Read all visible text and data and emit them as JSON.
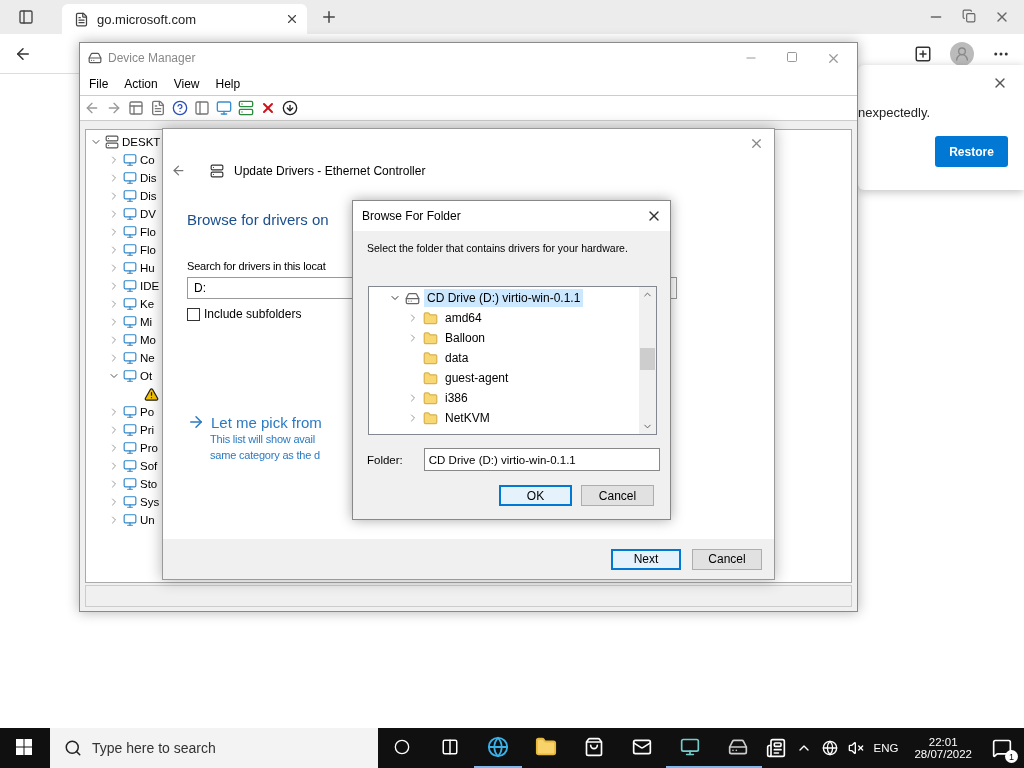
{
  "browser": {
    "tab": {
      "title": "go.microsoft.com"
    },
    "restore_popup": {
      "message": "nexpectedly.",
      "button": "Restore"
    }
  },
  "device_manager": {
    "title": "Device Manager",
    "menu": [
      "File",
      "Action",
      "View",
      "Help"
    ],
    "tree": {
      "label": "DESKT",
      "expanded": true,
      "children": [
        {
          "label": "Co",
          "expanded": false
        },
        {
          "label": "Dis",
          "expanded": false
        },
        {
          "label": "Dis",
          "expanded": false
        },
        {
          "label": "DV",
          "expanded": false
        },
        {
          "label": "Flo",
          "expanded": false
        },
        {
          "label": "Flo",
          "expanded": false
        },
        {
          "label": "Hu",
          "expanded": false
        },
        {
          "label": "IDE",
          "expanded": false
        },
        {
          "label": "Ke",
          "expanded": false
        },
        {
          "label": "Mi",
          "expanded": false
        },
        {
          "label": "Mo",
          "expanded": false
        },
        {
          "label": "Ne",
          "expanded": false
        },
        {
          "label": "Ot",
          "expanded": true,
          "children": [
            {
              "kind": "warning-device"
            }
          ]
        },
        {
          "label": "Po",
          "expanded": false
        },
        {
          "label": "Pri",
          "expanded": false
        },
        {
          "label": "Pro",
          "expanded": false
        },
        {
          "label": "Sof",
          "expanded": false
        },
        {
          "label": "Sto",
          "expanded": false
        },
        {
          "label": "Sys",
          "expanded": false
        },
        {
          "label": "Un",
          "expanded": false
        }
      ]
    }
  },
  "update_drivers": {
    "title": "Update Drivers - Ethernet Controller",
    "heading": "Browse for drivers on",
    "search_label": "Search for drivers in this locat",
    "location": "D:",
    "include_subfolders": {
      "label": "Include subfolders",
      "checked": false
    },
    "pick_link": "Let me pick from",
    "pick_description": [
      "This list will show avail",
      "same category as the d"
    ],
    "buttons": [
      {
        "label": "Next",
        "focused": true
      },
      {
        "label": "Cancel",
        "focused": false
      }
    ]
  },
  "browse_folder": {
    "title": "Browse For Folder",
    "instruction": "Select the folder that contains drivers for your hardware.",
    "tree": {
      "label": "CD Drive (D:) virtio-win-0.1.1",
      "expanded": true,
      "selected": true,
      "children": [
        {
          "label": "amd64",
          "expandable": true,
          "selected": false
        },
        {
          "label": "Balloon",
          "expandable": true,
          "selected": false
        },
        {
          "label": "data",
          "expandable": false,
          "selected": false
        },
        {
          "label": "guest-agent",
          "expandable": false,
          "selected": false
        },
        {
          "label": "i386",
          "expandable": true,
          "selected": false
        },
        {
          "label": "NetKVM",
          "expandable": true,
          "selected": false
        }
      ]
    },
    "folder_label": "Folder:",
    "folder_value": "CD Drive (D:) virtio-win-0.1.1",
    "buttons": [
      {
        "label": "OK",
        "focused": true
      },
      {
        "label": "Cancel",
        "focused": false
      }
    ]
  },
  "taskbar": {
    "search_placeholder": "Type here to search",
    "language": "ENG",
    "time": "22:01",
    "date": "28/07/2022",
    "notification_count": "1"
  }
}
